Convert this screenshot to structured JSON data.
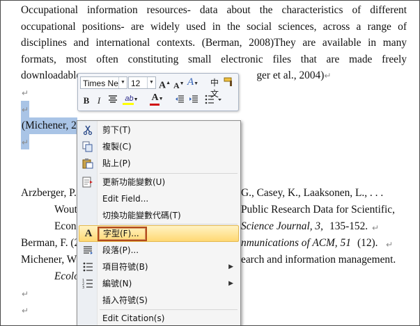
{
  "document": {
    "paragraph_lines": [
      "Occupational information resources- data about the characteristics of different",
      "occupational positions- are widely used in the social sciences, across a range of",
      "disciplines and international contexts. (Berman, 2008)They are available in many",
      "formats, most often constituting small electronic files that are made freely",
      "downloadable",
      "ger et al., 2004)"
    ],
    "selected_text": "(Michener,  2",
    "paragraph_mark": "↵",
    "references": {
      "arzberger_line1_a": "Arzberger, P.,",
      "arzberger_line1_b": "G., Casey, K., Laaksonen, L., . . .",
      "arzberger_line2_a": "Wout",
      "arzberger_line2_b": "Public Research Data for Scientific,",
      "arzberger_line3_a": "Econ",
      "arzberger_line3_b": "Science Journal, 3,",
      "arzberger_line3_c": "135-152.",
      "berman_a": "Berman, F. (2",
      "berman_b": "nmunications of ACM, 51",
      "berman_c": "(12).",
      "michener_a": "Michener, W",
      "michener_b": "earch and information management.",
      "ecolo": "Ecolo"
    }
  },
  "mini_toolbar": {
    "font_name": "Times Ne",
    "font_size": "12",
    "grow_font": "A",
    "shrink_font": "A",
    "styles": "A",
    "phonetic": "中文",
    "bold": "B",
    "italic": "I",
    "highlight_label": "ab",
    "font_color_label": "A"
  },
  "context_menu": {
    "items": [
      {
        "label": "剪下(T)",
        "icon": "cut-icon"
      },
      {
        "label": "複製(C)",
        "icon": "copy-icon"
      },
      {
        "label": "貼上(P)",
        "icon": "paste-icon"
      },
      {
        "label": "更新功能變數(U)",
        "icon": "update-field-icon"
      },
      {
        "label": "Edit Field...",
        "icon": ""
      },
      {
        "label": "切換功能變數代碼(T)",
        "icon": ""
      },
      {
        "label": "字型(F)...",
        "icon": "font-icon",
        "highlighted": true
      },
      {
        "label": "段落(P)...",
        "icon": "paragraph-icon"
      },
      {
        "label": "項目符號(B)",
        "icon": "bullets-icon",
        "submenu": true
      },
      {
        "label": "編號(N)",
        "icon": "numbering-icon",
        "submenu": true
      },
      {
        "label": "插入符號(S)",
        "icon": ""
      },
      {
        "label": "Edit Citation(s)",
        "icon": ""
      }
    ]
  },
  "colors": {
    "selection": "#a9c4e6",
    "menu_highlight": "#ffd873",
    "focus_box": "#b34a1a"
  }
}
